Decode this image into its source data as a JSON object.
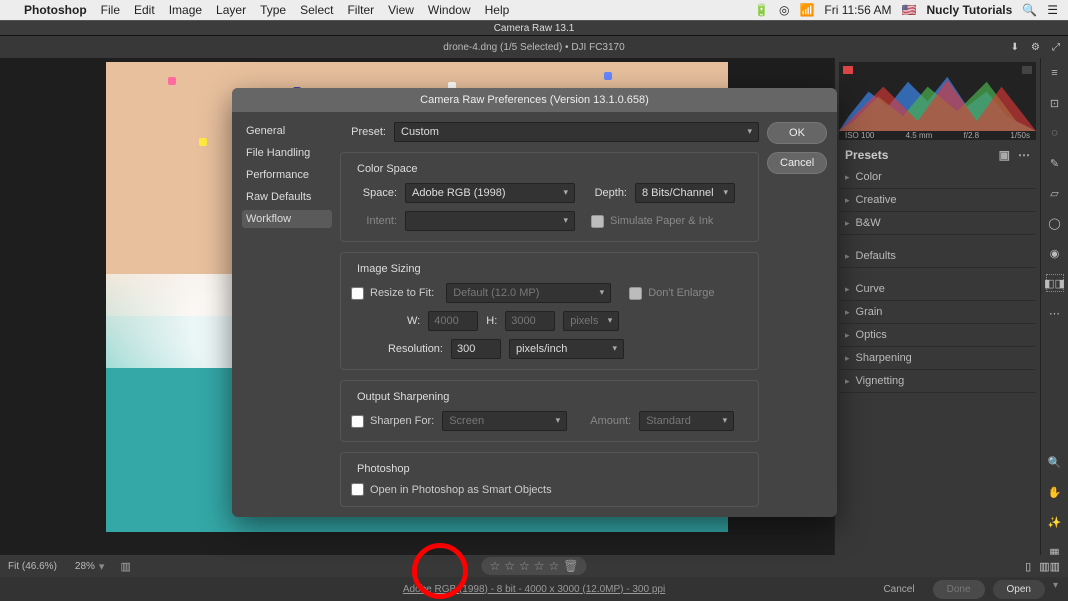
{
  "menubar": {
    "app": "Photoshop",
    "items": [
      "File",
      "Edit",
      "Image",
      "Layer",
      "Type",
      "Select",
      "Filter",
      "View",
      "Window",
      "Help"
    ],
    "clock": "Fri 11:56 AM",
    "user": "Nucly Tutorials"
  },
  "app_title": "Camera Raw 13.1",
  "subbar": {
    "filename": "drone-4.dng (1/5 Selected)  •  DJI FC3170"
  },
  "right_panel": {
    "histogram_info": {
      "iso": "ISO 100",
      "focal": "4.5 mm",
      "aperture": "f/2.8",
      "shutter": "1/50s"
    },
    "presets_title": "Presets",
    "groups": [
      "Color",
      "Creative",
      "B&W"
    ],
    "defaults": "Defaults",
    "adjust": [
      "Curve",
      "Grain",
      "Optics",
      "Sharpening",
      "Vignetting"
    ]
  },
  "modal": {
    "title": "Camera Raw Preferences  (Version 13.1.0.658)",
    "tabs": {
      "general": "General",
      "file": "File Handling",
      "perf": "Performance",
      "rawdef": "Raw Defaults",
      "workflow": "Workflow"
    },
    "ok": "OK",
    "cancel": "Cancel",
    "preset_label": "Preset:",
    "preset_value": "Custom",
    "cs": {
      "title": "Color Space",
      "space_label": "Space:",
      "space_value": "Adobe RGB (1998)",
      "depth_label": "Depth:",
      "depth_value": "8 Bits/Channel",
      "intent_label": "Intent:",
      "sim": "Simulate Paper & Ink"
    },
    "is": {
      "title": "Image Sizing",
      "resize_label": "Resize to Fit:",
      "resize_value": "Default  (12.0 MP)",
      "dont_enlarge": "Don't Enlarge",
      "w": "W:",
      "w_val": "4000",
      "h": "H:",
      "h_val": "3000",
      "units": "pixels",
      "res_label": "Resolution:",
      "res_val": "300",
      "res_units": "pixels/inch"
    },
    "os": {
      "title": "Output Sharpening",
      "sharpen_for_label": "Sharpen For:",
      "sharpen_for_value": "Screen",
      "amount_label": "Amount:",
      "amount_value": "Standard"
    },
    "ps": {
      "title": "Photoshop",
      "smart": "Open in Photoshop as Smart Objects"
    }
  },
  "bottom": {
    "zoom": "Fit (46.6%)",
    "pct": "28%",
    "summary": "Adobe RGB (1998) - 8 bit - 4000 x 3000 (12.0MP) - 300 ppi",
    "cancel": "Cancel",
    "done": "Done",
    "open": "Open"
  }
}
